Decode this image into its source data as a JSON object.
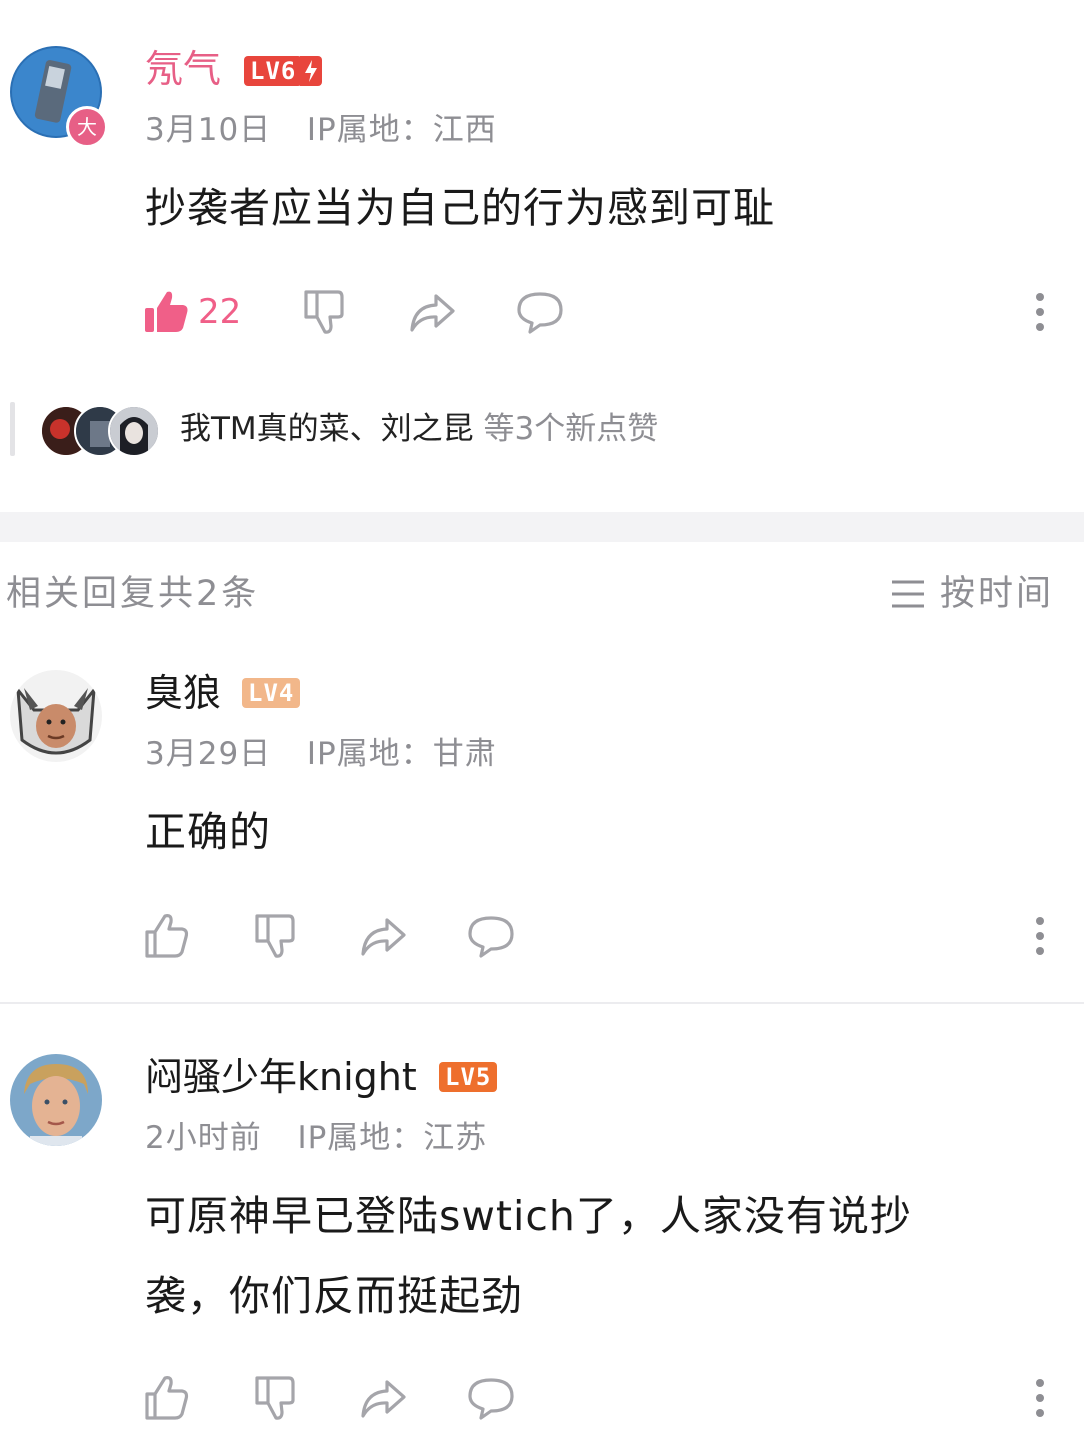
{
  "main_comment": {
    "username": "氖气",
    "level": "LV6",
    "date": "3月10日",
    "ip_label": "IP属地：",
    "ip_location": "江西",
    "text": "抄袭者应当为自己的行为感到可耻",
    "like_count": "22",
    "avatar_badge": "大",
    "likers": {
      "names": "我TM真的菜、刘之昆",
      "suffix": "等3个新点赞"
    }
  },
  "replies_header": {
    "label": "相关回复共2条",
    "sort_label": "按时间"
  },
  "replies": [
    {
      "username": "臭狼",
      "level": "LV4",
      "date": "3月29日",
      "ip_label": "IP属地：",
      "ip_location": "甘肃",
      "text": "正确的"
    },
    {
      "username": "闷骚少年knight",
      "level": "LV5",
      "date": "2小时前",
      "ip_label": "IP属地：",
      "ip_location": "江苏",
      "text_line1": "可原神早已登陆swtich了，人家没有说抄",
      "text_line2": "袭，你们反而挺起劲"
    }
  ],
  "icons": [
    "thumbs-up-icon",
    "thumbs-down-icon",
    "share-icon",
    "comment-icon",
    "more-icon",
    "sort-icon"
  ],
  "colors": {
    "username_main": "#e75f86",
    "lv6": "#e8453c",
    "lv4": "#f2b78a",
    "lv5": "#ee6f2d",
    "like_active": "#f05f88",
    "meta": "#8e8e93",
    "icon_gray": "#a5a5aa"
  }
}
